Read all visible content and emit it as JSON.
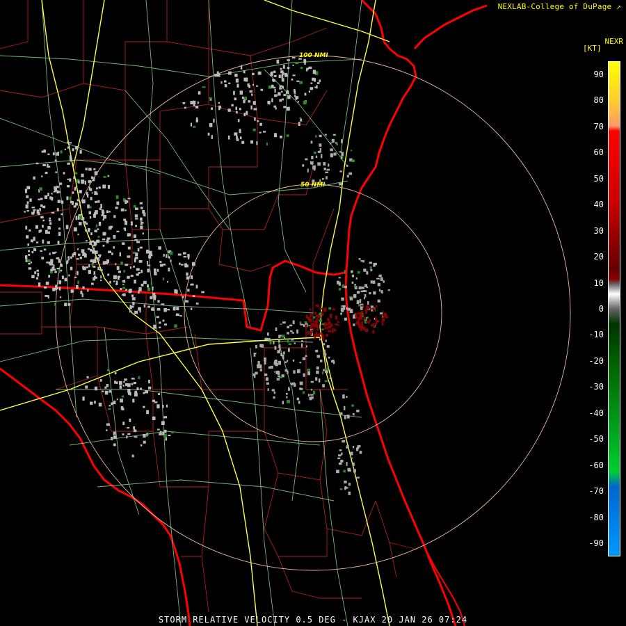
{
  "header": {
    "credit": "NEXLAB-College of DuPage",
    "product": "NEXR",
    "units": "[KT]"
  },
  "legend": {
    "ticks": [
      "90",
      "80",
      "70",
      "60",
      "50",
      "40",
      "30",
      "20",
      "10",
      "0",
      "-10",
      "-20",
      "-30",
      "-40",
      "-50",
      "-60",
      "-70",
      "-80",
      "-90"
    ],
    "scale_max": 95,
    "scale_min": -95
  },
  "rings": [
    "100 NMI",
    "50 NMI"
  ],
  "footer": "STORM RELATIVE VELOCITY 0.5 DEG - KJAX 20 JAN 26 07:24",
  "colors": {
    "background": "#000000",
    "coastline": "#ff0000",
    "state_border": "#ff0000",
    "county_border": "#b02020",
    "highway": "#ffff44",
    "road": "#90d890",
    "range_ring": "#e8b8a0",
    "label": "#ffff00"
  }
}
